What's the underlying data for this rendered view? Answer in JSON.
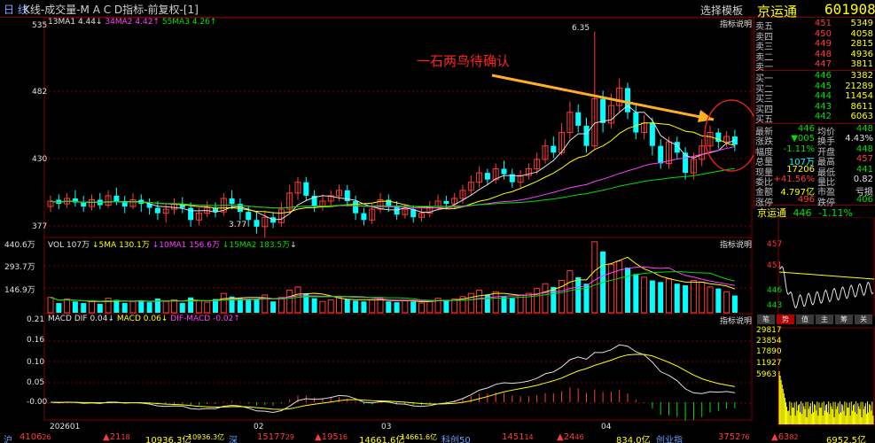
{
  "header": {
    "period": "日 线",
    "title": "K线-成交量-M A C D指标-前复权-[1]",
    "template_button": "选择模板",
    "stock_name": "京运通",
    "stock_code": "601908"
  },
  "panels": {
    "main_label": "指标说明",
    "vol_label": "指标说明",
    "macd_label": "指标说明"
  },
  "ma_legend": {
    "ma13": "13MA1 4.44",
    "ma13_arrow": "↓",
    "ma34": "34MA2 4.42",
    "ma34_arrow": "↑",
    "ma55": "55MA3 4.26",
    "ma55_arrow": "↑"
  },
  "vol_legend": {
    "vol": "VOL 107万",
    "ma5": "↓5MA 130.1万",
    "ma10": "↓10MA1 156.6万",
    "ma15": "↓15MA2 183.5万",
    "arrow": "↓"
  },
  "macd_legend": {
    "dif": "MACD DIF 0.04",
    "dif_arrow": "↓",
    "macd": "MACD 0.06",
    "macd_arrow": "↓",
    "difmacd": "DIF-MACD -0.02",
    "difmacd_arrow": "↑"
  },
  "price_axis": [
    "535",
    "482",
    "430",
    "377"
  ],
  "vol_axis": [
    "440.6万",
    "293.7万",
    "146.9万"
  ],
  "macd_axis": [
    "0.21",
    "0.16",
    "0.10",
    "0.05",
    "-0.00"
  ],
  "date_axis": [
    "202601",
    "02",
    "03",
    "04"
  ],
  "annotations": {
    "high_label": "6.35",
    "low_label": "3.77",
    "pattern_text": "一石两鸟待确认"
  },
  "order_book": {
    "asks": [
      {
        "label": "卖五",
        "price": "451",
        "vol": "5349"
      },
      {
        "label": "卖四",
        "price": "450",
        "vol": "4058"
      },
      {
        "label": "卖三",
        "price": "449",
        "vol": "2815"
      },
      {
        "label": "卖二",
        "price": "448",
        "vol": "4936"
      },
      {
        "label": "卖一",
        "price": "447",
        "vol": "3811"
      }
    ],
    "bids": [
      {
        "label": "买一",
        "price": "446",
        "vol": "3382"
      },
      {
        "label": "买二",
        "price": "445",
        "vol": "21289"
      },
      {
        "label": "买三",
        "price": "444",
        "vol": "11454"
      },
      {
        "label": "买四",
        "price": "443",
        "vol": "8611"
      },
      {
        "label": "买五",
        "price": "442",
        "vol": "6063"
      }
    ]
  },
  "stats": [
    {
      "l1": "最新",
      "v1": "446",
      "l2": "均价",
      "v2": "448"
    },
    {
      "l1": "涨跌",
      "v1": "▼005",
      "l2": "换手",
      "v2": "4.43%"
    },
    {
      "l1": "幅度",
      "v1": "-1.11%",
      "l2": "开盘",
      "v2": "448"
    },
    {
      "l1": "总量",
      "v1": "107万",
      "l2": "最高",
      "v2": "457"
    },
    {
      "l1": "现量",
      "v1": "17206",
      "l2": "最低",
      "v2": "441"
    },
    {
      "l1": "委比",
      "v1": "+41.56%",
      "l2": "量比",
      "v2": "0.82"
    },
    {
      "l1": "金额",
      "v1": "4.797亿",
      "l2": "市盈",
      "v2": "亏损"
    },
    {
      "l1": "涨停",
      "v1": "496",
      "l2": "跌停",
      "v2": "406"
    }
  ],
  "mini": {
    "name": "京运通",
    "price": "446",
    "change": "-1.11%",
    "price_axis": [
      "457",
      "451",
      "446",
      "443"
    ],
    "vol_axis": [
      "29817",
      "23854",
      "17890",
      "11927",
      "5963"
    ],
    "tabs": [
      "笔",
      "势",
      "值",
      "主",
      "筹",
      "关"
    ]
  },
  "bottom": {
    "sh_label": "沪",
    "sh_index": "4106",
    "sh_index_dec": "26",
    "sh_change": "▲21",
    "sh_change_dec": "18",
    "sh_amount": "10936.3亿",
    "sh_amount2": "10936.3亿",
    "sz_label": "深",
    "sz_index": "15177",
    "sz_index_dec": "29",
    "sz_change": "▲195",
    "sz_change_dec": "16",
    "sz_amount": "14661.6亿",
    "sz_amount2": "14661.6亿",
    "kc_label": "科创50",
    "kc_index": "1451",
    "kc_index_dec": "14",
    "kc_change": "▲24",
    "kc_change_dec": "46",
    "kc_amount": "834.0亿",
    "cy_label": "创业指",
    "cy_index": "3752",
    "cy_index_dec": "76",
    "cy_change": "▲63",
    "cy_change_dec": "82",
    "cy_amount": "6952.5亿"
  },
  "colors": {
    "up": "#ff3b3b",
    "down": "#00ffff",
    "grid": "#7a0000",
    "ma13": "#e0e0e0",
    "ma34": "#ffff00",
    "ma55": "#ff40ff",
    "ma_green": "#00e000",
    "arrow": "#ffb020",
    "circle": "#e02020"
  }
}
